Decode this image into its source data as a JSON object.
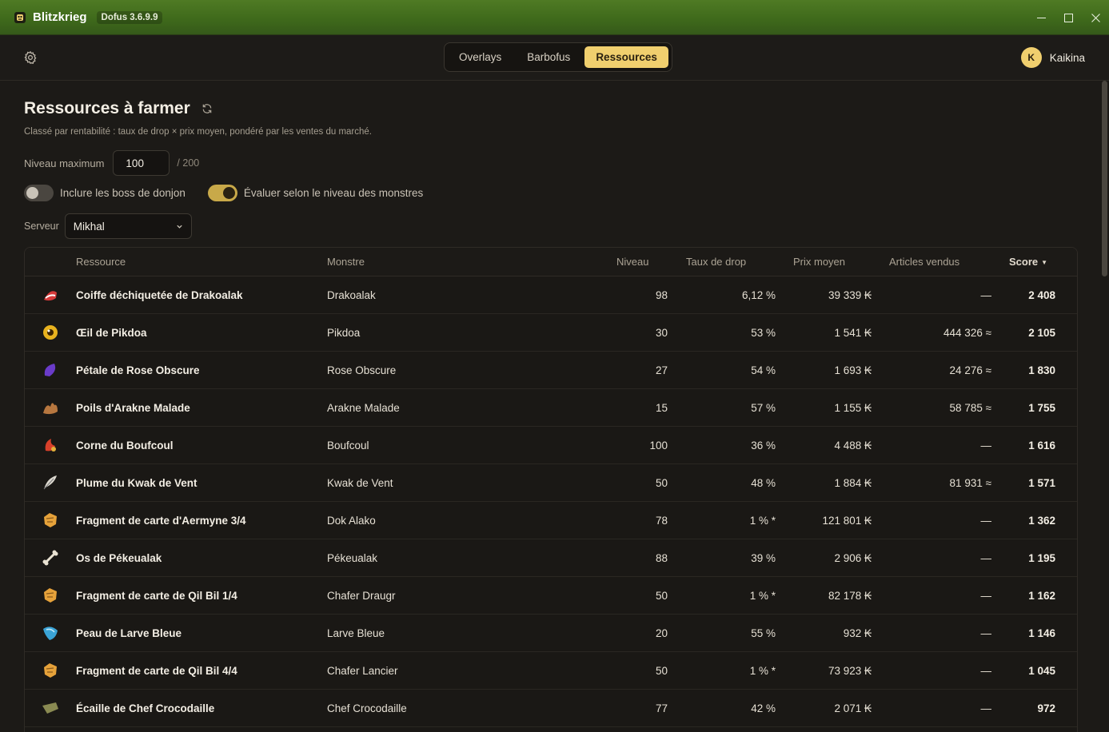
{
  "window": {
    "app_name": "Blitzkrieg",
    "version": "Dofus 3.6.9.9"
  },
  "nav": {
    "tabs": [
      {
        "label": "Overlays",
        "active": false
      },
      {
        "label": "Barbofus",
        "active": false
      },
      {
        "label": "Ressources",
        "active": true
      }
    ],
    "user": {
      "initial": "K",
      "name": "Kaikina"
    }
  },
  "page": {
    "title": "Ressources à farmer",
    "subtitle": "Classé par rentabilité : taux de drop × prix moyen, pondéré par les ventes du marché.",
    "level_label": "Niveau maximum",
    "level_value": "100",
    "level_max": "/ 200",
    "toggle_boss_label": "Inclure les boss de donjon",
    "toggle_boss_on": false,
    "toggle_monster_label": "Évaluer selon le niveau des monstres",
    "toggle_monster_on": true,
    "server_label": "Serveur",
    "server_value": "Mikhal"
  },
  "table": {
    "headers": {
      "resource": "Ressource",
      "monster": "Monstre",
      "level": "Niveau",
      "drop": "Taux de drop",
      "price": "Prix moyen",
      "sold": "Articles vendus",
      "score": "Score"
    },
    "rows": [
      {
        "icon": "hat-icon",
        "color": "#d63a3a",
        "resource": "Coiffe déchiquetée de Drakoalak",
        "monster": "Drakoalak",
        "level": "98",
        "drop": "6,12 %",
        "price": "39 339 ₭",
        "sold": "—",
        "score": "2 408"
      },
      {
        "icon": "eye-icon",
        "color": "#e8b21e",
        "resource": "Œil de Pikdoa",
        "monster": "Pikdoa",
        "level": "30",
        "drop": "53 %",
        "price": "1 541 ₭",
        "sold": "444 326 ≈",
        "score": "2 105"
      },
      {
        "icon": "petal-icon",
        "color": "#6a3bc9",
        "resource": "Pétale de Rose Obscure",
        "monster": "Rose Obscure",
        "level": "27",
        "drop": "54 %",
        "price": "1 693 ₭",
        "sold": "24 276 ≈",
        "score": "1 830"
      },
      {
        "icon": "fur-icon",
        "color": "#b7773f",
        "resource": "Poils d'Arakne Malade",
        "monster": "Arakne Malade",
        "level": "15",
        "drop": "57 %",
        "price": "1 155 ₭",
        "sold": "58 785 ≈",
        "score": "1 755"
      },
      {
        "icon": "horn-icon",
        "color": "#d8402a",
        "resource": "Corne du Boufcoul",
        "monster": "Boufcoul",
        "level": "100",
        "drop": "36 %",
        "price": "4 488 ₭",
        "sold": "—",
        "score": "1 616"
      },
      {
        "icon": "feather-icon",
        "color": "#dcd8cf",
        "resource": "Plume du Kwak de Vent",
        "monster": "Kwak de Vent",
        "level": "50",
        "drop": "48 %",
        "price": "1 884 ₭",
        "sold": "81 931 ≈",
        "score": "1 571"
      },
      {
        "icon": "map-fragment-icon",
        "color": "#e6a23a",
        "resource": "Fragment de carte d'Aermyne 3/4",
        "monster": "Dok Alako",
        "level": "78",
        "drop": "1 % *",
        "price": "121 801 ₭",
        "sold": "—",
        "score": "1 362"
      },
      {
        "icon": "bone-icon",
        "color": "#e9e2d2",
        "resource": "Os de Pékeualak",
        "monster": "Pékeualak",
        "level": "88",
        "drop": "39 %",
        "price": "2 906 ₭",
        "sold": "—",
        "score": "1 195"
      },
      {
        "icon": "map-fragment-icon",
        "color": "#e6a23a",
        "resource": "Fragment de carte de Qil Bil 1/4",
        "monster": "Chafer Draugr",
        "level": "50",
        "drop": "1 % *",
        "price": "82 178 ₭",
        "sold": "—",
        "score": "1 162"
      },
      {
        "icon": "skin-icon",
        "color": "#3aa3d6",
        "resource": "Peau de Larve Bleue",
        "monster": "Larve Bleue",
        "level": "20",
        "drop": "55 %",
        "price": "932 ₭",
        "sold": "—",
        "score": "1 146"
      },
      {
        "icon": "map-fragment-icon",
        "color": "#e6a23a",
        "resource": "Fragment de carte de Qil Bil 4/4",
        "monster": "Chafer Lancier",
        "level": "50",
        "drop": "1 % *",
        "price": "73 923 ₭",
        "sold": "—",
        "score": "1 045"
      },
      {
        "icon": "scale-icon",
        "color": "#8a8a52",
        "resource": "Écaille de Chef Crocodaille",
        "monster": "Chef Crocodaille",
        "level": "77",
        "drop": "42 %",
        "price": "2 071 ₭",
        "sold": "—",
        "score": "972"
      }
    ]
  }
}
